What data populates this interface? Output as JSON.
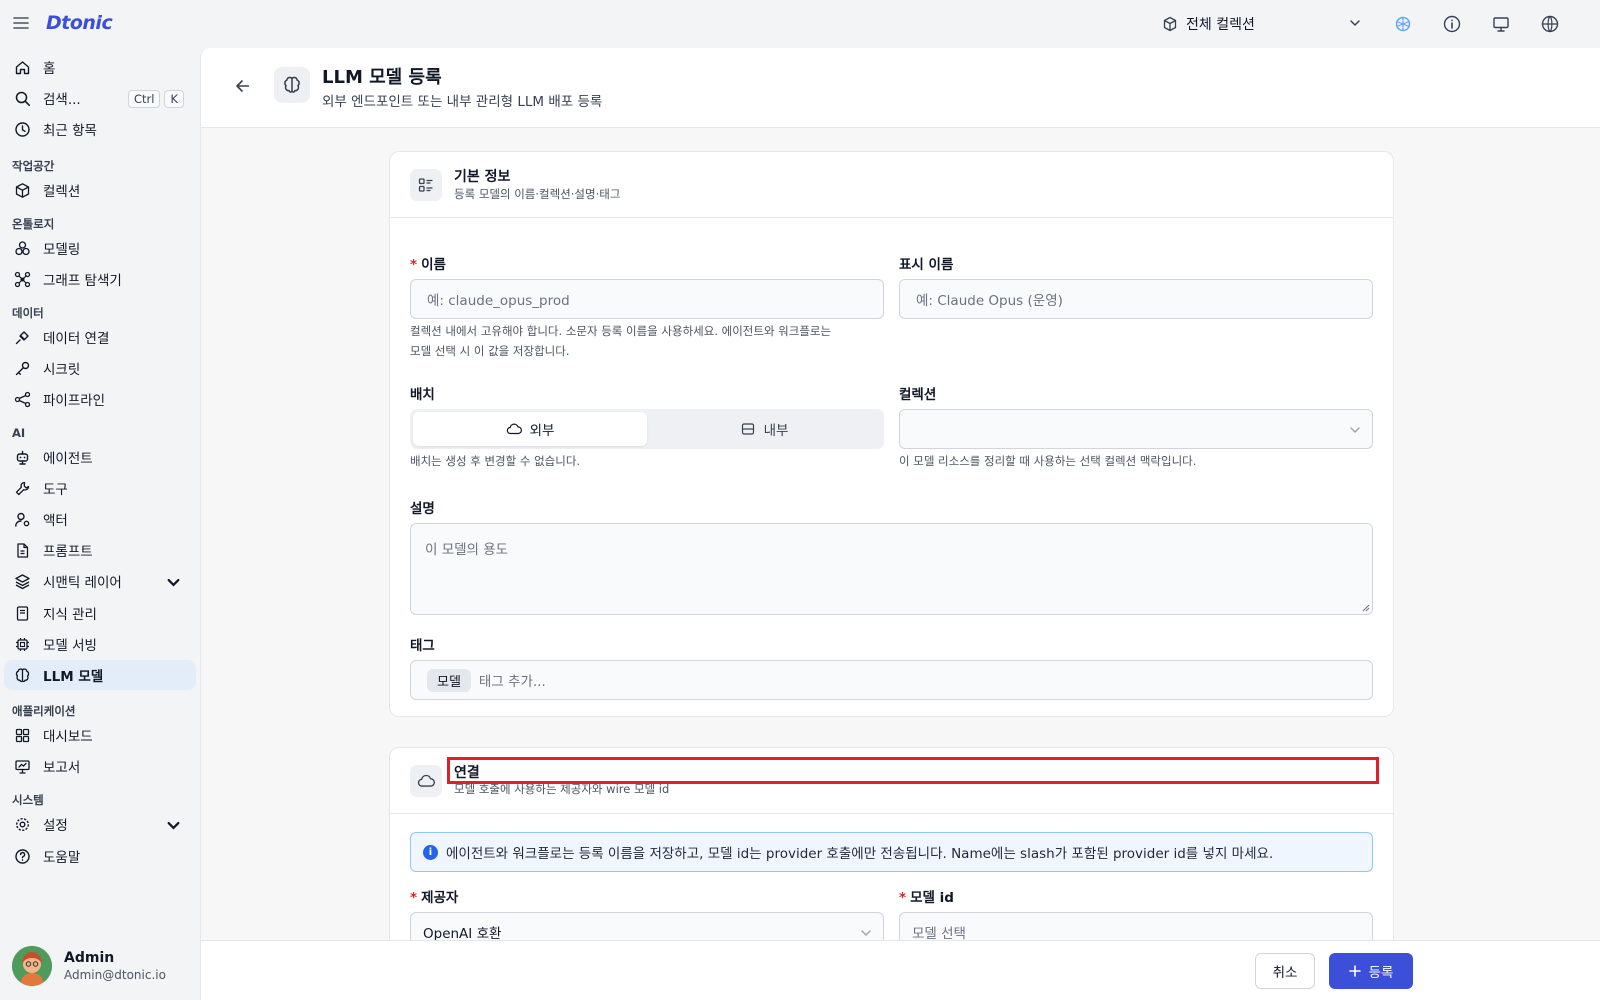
{
  "app": {
    "logo": "Dtonic",
    "collection_selector": "전체 컬렉션"
  },
  "sidebar": {
    "home": "홈",
    "search": "검색...",
    "search_shortcut": [
      "Ctrl",
      "K"
    ],
    "recent": "최근 항목",
    "sections": {
      "workspace": "작업공간",
      "ontology": "온톨로지",
      "data": "데이터",
      "ai": "AI",
      "apps": "애플리케이션",
      "system": "시스템"
    },
    "items": {
      "collections": "컬렉션",
      "modeling": "모델링",
      "graph_explorer": "그래프 탐색기",
      "data_connection": "데이터 연결",
      "secrets": "시크릿",
      "pipeline": "파이프라인",
      "agent": "에이전트",
      "tools": "도구",
      "actor": "액터",
      "prompt": "프롬프트",
      "semantic_layer": "시맨틱 레이어",
      "knowledge": "지식 관리",
      "model_serving": "모델 서빙",
      "llm_models": "LLM 모델",
      "dashboard": "대시보드",
      "report": "보고서",
      "settings": "설정",
      "help": "도움말"
    },
    "user": {
      "name": "Admin",
      "email": "Admin@dtonic.io"
    }
  },
  "page": {
    "title": "LLM 모델 등록",
    "subtitle": "외부 엔드포인트 또는 내부 관리형 LLM 배포 등록"
  },
  "basic_info": {
    "title": "기본 정보",
    "subtitle": "등록 모델의 이름·컬렉션·설명·태그",
    "name_label": "이름",
    "name_placeholder": "예: claude_opus_prod",
    "name_help_1": "컬렉션 내에서 고유해야 합니다. 소문자 등록 이름을 사용하세요. 에이전트와 워크플로는",
    "name_help_2": "모델 선택 시 이 값을 저장합니다.",
    "display_name_label": "표시 이름",
    "display_name_placeholder": "예: Claude Opus (운영)",
    "deployment_label": "배치",
    "deployment_external": "외부",
    "deployment_internal": "내부",
    "deployment_help": "배치는 생성 후 변경할 수 없습니다.",
    "collection_label": "컬렉션",
    "collection_value": "",
    "collection_help": "이 모델 리소스를 정리할 때 사용하는 선택 컬렉션 맥락입니다.",
    "description_label": "설명",
    "description_placeholder": "이 모델의 용도",
    "tags_label": "태그",
    "tags": [
      "모델"
    ],
    "tags_placeholder": "태그 추가..."
  },
  "connection": {
    "title": "연결",
    "subtitle": "모델 호출에 사용하는 제공자와 wire 모델 id",
    "info": "에이전트와 워크플로는 등록 이름을 저장하고, 모델 id는 provider 호출에만 전송됩니다. Name에는 slash가 포함된 provider id를 넣지 마세요.",
    "provider_label": "제공자",
    "provider_value": "OpenAI 호환",
    "model_id_label": "모델 id",
    "model_id_placeholder": "모델 선택"
  },
  "footer": {
    "cancel": "취소",
    "submit": "등록"
  },
  "colors": {
    "accent": "#3b4fd8",
    "highlight": "#e11d2e",
    "required": "#dc2626"
  }
}
